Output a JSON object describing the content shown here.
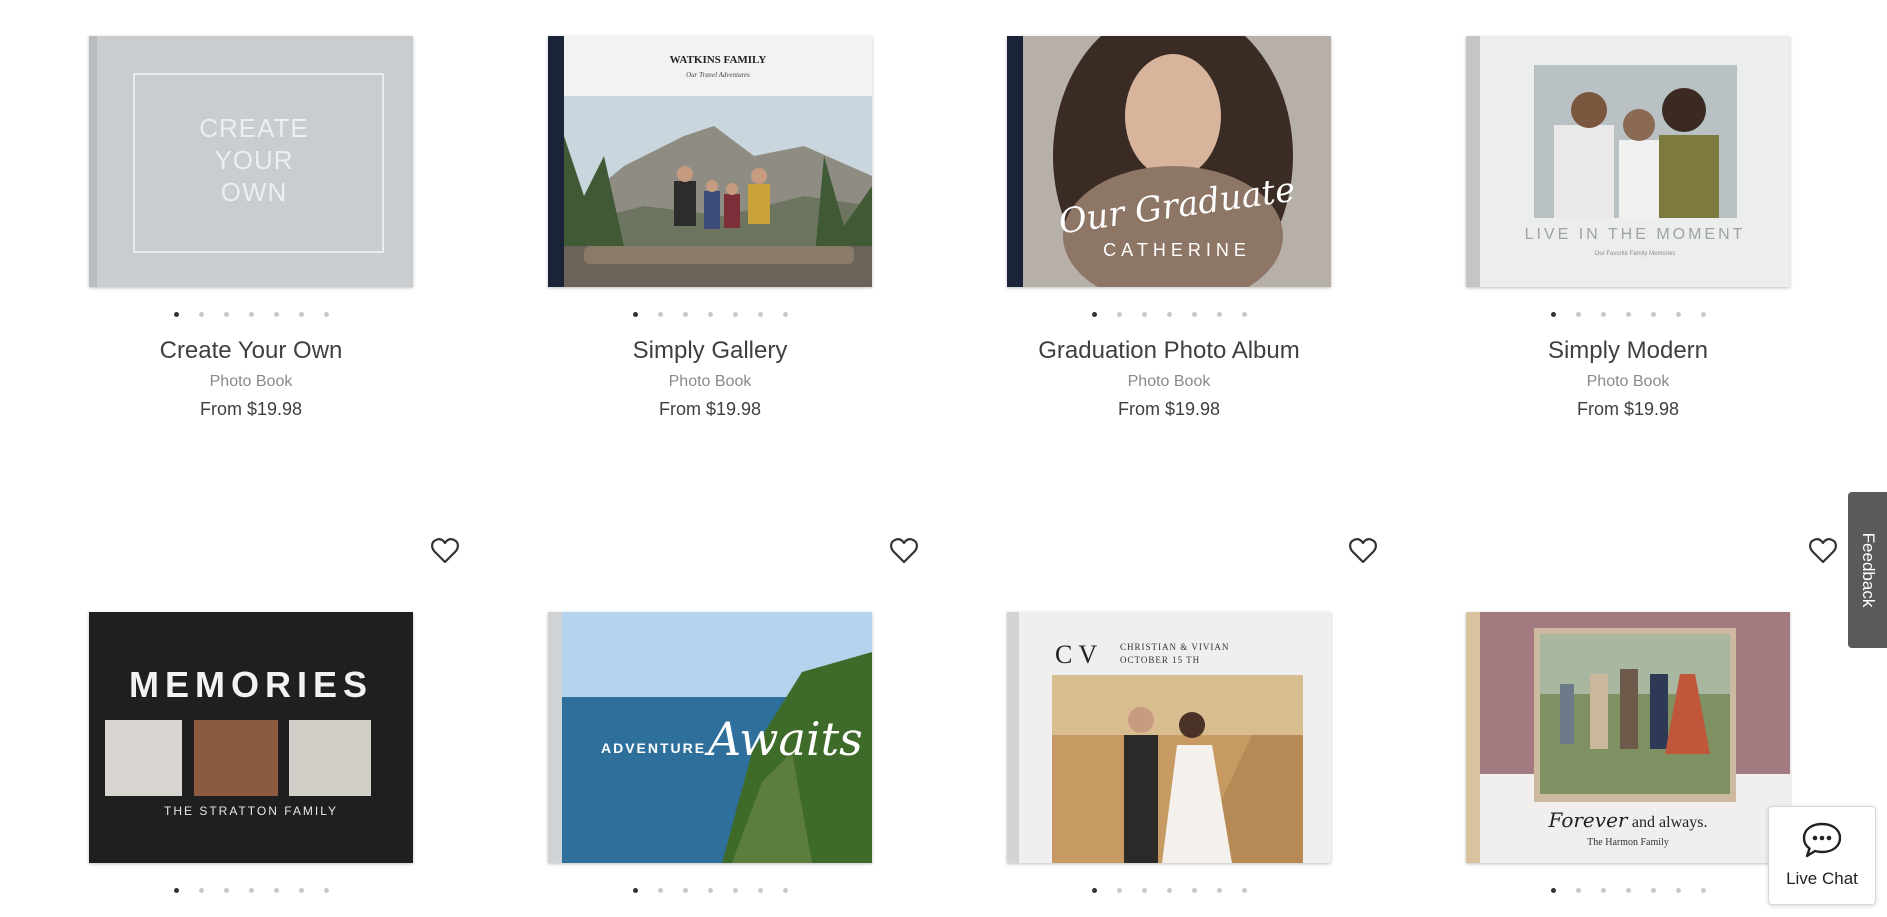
{
  "products": [
    {
      "title": "Create Your Own",
      "type": "Photo Book",
      "price": "From $19.98",
      "cover_text": "CREATE YOUR OWN"
    },
    {
      "title": "Simply Gallery",
      "type": "Photo Book",
      "price": "From $19.98",
      "cover_title": "WATKINS FAMILY",
      "cover_subtitle": "Our Travel Adventures"
    },
    {
      "title": "Graduation Photo Album",
      "type": "Photo Book",
      "price": "From $19.98",
      "cover_script": "Our Graduate",
      "cover_name": "CATHERINE"
    },
    {
      "title": "Simply Modern",
      "type": "Photo Book",
      "price": "From $19.98",
      "cover_title": "LIVE IN THE MOMENT",
      "cover_subtitle": "Our Favorite Family Memories"
    }
  ],
  "row2": [
    {
      "cover_title": "MEMORIES",
      "cover_subtitle": "THE STRATTON FAMILY"
    },
    {
      "cover_word": "ADVENTURE",
      "cover_script": "Awaits"
    },
    {
      "monogram": "C V",
      "names": "CHRISTIAN & VIVIAN",
      "date": "OCTOBER 15 TH"
    },
    {
      "cover_script": "Forever",
      "cover_rest": "and always.",
      "cover_family": "The Harmon Family"
    }
  ],
  "carousel": {
    "dot_count": 7,
    "active_index": 0
  },
  "widgets": {
    "feedback_label": "Feedback",
    "livechat_label": "Live Chat"
  },
  "icons": {
    "favorite": "heart-outline-icon",
    "chat": "chat-bubble-icon"
  },
  "colors": {
    "spine_navy": "#1b2338",
    "cover_gray": "#c9ccce",
    "accent_dark": "#222222"
  }
}
